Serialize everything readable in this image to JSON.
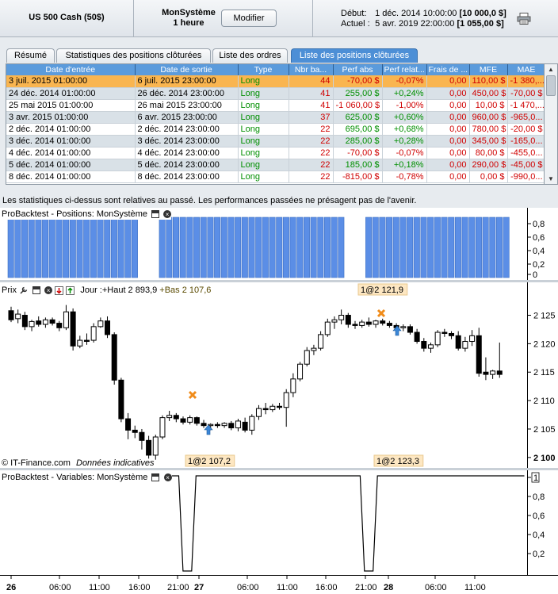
{
  "header": {
    "instrument": "US 500 Cash (50$)",
    "system_name": "MonSystème",
    "system_period": "1 heure",
    "modify_label": "Modifier",
    "start_label": "Début:",
    "start_value": "1 déc. 2014 10:00:00",
    "start_capital": "[10 000,0 $]",
    "current_label": "Actuel :",
    "current_value": "5 avr. 2019 22:00:00",
    "current_capital": "[1 055,00 $]",
    "printer_icon": "printer-icon"
  },
  "tabs": [
    {
      "label": "Résumé",
      "active": false
    },
    {
      "label": "Statistiques des positions clôturées",
      "active": false
    },
    {
      "label": "Liste des ordres",
      "active": false
    },
    {
      "label": "Liste des positions clôturées",
      "active": true
    }
  ],
  "table": {
    "columns": [
      "Date d'entrée",
      "Date de sortie",
      "Type",
      "Nbr ba...",
      "Perf abs",
      "Perf relat...",
      "Frais de ...",
      "MFE",
      "MAE"
    ],
    "rows": [
      [
        "3 juil. 2015 01:00:00",
        "6 juil. 2015 23:00:00",
        "Long",
        "44",
        "-70,00 $",
        "-0,07%",
        "0,00",
        "110,00 $",
        "-1 380,..."
      ],
      [
        "24 déc. 2014 01:00:00",
        "26 déc. 2014 23:00:00",
        "Long",
        "41",
        "255,00 $",
        "+0,24%",
        "0,00",
        "450,00 $",
        "-70,00 $"
      ],
      [
        "25 mai 2015 01:00:00",
        "26 mai 2015 23:00:00",
        "Long",
        "41",
        "-1 060,00 $",
        "-1,00%",
        "0,00",
        "10,00 $",
        "-1 470,..."
      ],
      [
        "3 avr. 2015 01:00:00",
        "6 avr. 2015 23:00:00",
        "Long",
        "37",
        "625,00 $",
        "+0,60%",
        "0,00",
        "960,00 $",
        "-965,0..."
      ],
      [
        "2 déc. 2014 01:00:00",
        "2 déc. 2014 23:00:00",
        "Long",
        "22",
        "695,00 $",
        "+0,68%",
        "0,00",
        "780,00 $",
        "-20,00 $"
      ],
      [
        "3 déc. 2014 01:00:00",
        "3 déc. 2014 23:00:00",
        "Long",
        "22",
        "285,00 $",
        "+0,28%",
        "0,00",
        "345,00 $",
        "-165,0..."
      ],
      [
        "4 déc. 2014 01:00:00",
        "4 déc. 2014 23:00:00",
        "Long",
        "22",
        "-70,00 $",
        "-0,07%",
        "0,00",
        "80,00 $",
        "-455,0..."
      ],
      [
        "5 déc. 2014 01:00:00",
        "5 déc. 2014 23:00:00",
        "Long",
        "22",
        "185,00 $",
        "+0,18%",
        "0,00",
        "290,00 $",
        "-45,00 $"
      ],
      [
        "8 déc. 2014 01:00:00",
        "8 déc. 2014 23:00:00",
        "Long",
        "22",
        "-815,00 $",
        "-0,78%",
        "0,00",
        "0,00 $",
        "-990,0..."
      ]
    ]
  },
  "disclaimer": "Les statistiques ci-dessus sont relatives au passé. Les performances passées ne présagent pas de l'avenir.",
  "positions_panel": {
    "title": "ProBacktest - Positions: MonSystème",
    "axis_ticks": [
      "0,8",
      "0,6",
      "0,4",
      "0,2",
      "0"
    ]
  },
  "price_panel": {
    "title": "Prix",
    "info": "Jour :+Haut 2 893,9",
    "info_overlap": "+Bas 2 107,6",
    "axis_ticks": [
      "2 125",
      "2 120",
      "2 115",
      "2 110",
      "2 105",
      "2 100"
    ],
    "order_labels": [
      "1@2 121,9",
      "1@2 107,2",
      "1@2 123,3"
    ],
    "watermark": "© IT-Finance.com",
    "watermark_note": "Données indicatives"
  },
  "variables_panel": {
    "title": "ProBacktest - Variables: MonSystème",
    "axis_ticks": [
      "1",
      "0,8",
      "0,6",
      "0,4",
      "0,2"
    ]
  },
  "time_axis": [
    "26",
    "06:00",
    "11:00",
    "16:00",
    "21:00",
    "27",
    "06:00",
    "11:00",
    "16:00",
    "21:00",
    "28",
    "06:00",
    "11:00"
  ],
  "chart_data": [
    {
      "type": "bar",
      "title": "ProBacktest - Positions: MonSystème",
      "values": [
        1,
        1,
        1,
        1,
        1,
        1,
        1,
        1,
        1,
        1,
        1,
        1,
        1,
        1,
        1,
        1,
        1,
        1,
        1,
        0,
        0,
        0,
        1,
        1,
        1,
        1,
        1,
        1,
        1,
        1,
        1,
        1,
        1,
        1,
        1,
        1,
        1,
        1,
        1,
        1,
        1,
        1,
        1,
        1,
        1,
        1,
        1,
        1,
        1,
        0,
        0,
        0,
        1,
        1,
        1,
        1,
        1,
        1,
        1,
        1,
        1,
        1,
        1,
        1,
        1,
        1,
        1,
        1,
        1,
        1,
        1,
        1,
        1
      ],
      "ylim": [
        0,
        1
      ]
    },
    {
      "type": "candlestick",
      "title": "Prix",
      "ylim": [
        2099,
        2128
      ],
      "candles": [
        {
          "o": 2125.8,
          "h": 2126.5,
          "l": 2123.8,
          "c": 2124.2
        },
        {
          "o": 2124.4,
          "h": 2126,
          "l": 2123.6,
          "c": 2125.2
        },
        {
          "o": 2125,
          "h": 2125.6,
          "l": 2122.4,
          "c": 2123
        },
        {
          "o": 2123,
          "h": 2124.2,
          "l": 2122.2,
          "c": 2123.9
        },
        {
          "o": 2124,
          "h": 2124.8,
          "l": 2123,
          "c": 2123.4
        },
        {
          "o": 2123.4,
          "h": 2124.6,
          "l": 2122.8,
          "c": 2124.2
        },
        {
          "o": 2124.2,
          "h": 2124.6,
          "l": 2123.2,
          "c": 2123.6
        },
        {
          "o": 2123.6,
          "h": 2124,
          "l": 2122.2,
          "c": 2122.8
        },
        {
          "o": 2122.8,
          "h": 2126.8,
          "l": 2122.4,
          "c": 2125.6
        },
        {
          "o": 2125.6,
          "h": 2126.2,
          "l": 2118.8,
          "c": 2119.6
        },
        {
          "o": 2119.6,
          "h": 2121.4,
          "l": 2119.2,
          "c": 2120.6
        },
        {
          "o": 2120.6,
          "h": 2121.8,
          "l": 2119.8,
          "c": 2120.4
        },
        {
          "o": 2120.6,
          "h": 2123.6,
          "l": 2120.2,
          "c": 2123
        },
        {
          "o": 2123,
          "h": 2124.6,
          "l": 2122.8,
          "c": 2124
        },
        {
          "o": 2124,
          "h": 2124.8,
          "l": 2121,
          "c": 2121.6
        },
        {
          "o": 2121.6,
          "h": 2122,
          "l": 2112.8,
          "c": 2113.6
        },
        {
          "o": 2113.6,
          "h": 2114,
          "l": 2106.2,
          "c": 2106.8
        },
        {
          "o": 2106.8,
          "h": 2107.8,
          "l": 2103.2,
          "c": 2104.8
        },
        {
          "o": 2104.8,
          "h": 2105.6,
          "l": 2103.4,
          "c": 2104.4
        },
        {
          "o": 2104.4,
          "h": 2105,
          "l": 2101.4,
          "c": 2103
        },
        {
          "o": 2103,
          "h": 2103.8,
          "l": 2099.8,
          "c": 2100.4
        },
        {
          "o": 2100.4,
          "h": 2104,
          "l": 2099.6,
          "c": 2103.6
        },
        {
          "o": 2103.6,
          "h": 2107.4,
          "l": 2103.2,
          "c": 2107
        },
        {
          "o": 2107,
          "h": 2108.2,
          "l": 2106.4,
          "c": 2107.4
        },
        {
          "o": 2107.4,
          "h": 2107.8,
          "l": 2106.2,
          "c": 2106.8
        },
        {
          "o": 2106.8,
          "h": 2107.2,
          "l": 2105.8,
          "c": 2106.2
        },
        {
          "o": 2106.2,
          "h": 2107.4,
          "l": 2105.8,
          "c": 2107
        },
        {
          "o": 2107,
          "h": 2107.2,
          "l": 2105.6,
          "c": 2106
        },
        {
          "o": 2106,
          "h": 2106.6,
          "l": 2105.2,
          "c": 2105.6
        },
        {
          "o": 2105.6,
          "h": 2106,
          "l": 2104.8,
          "c": 2105.8
        },
        {
          "o": 2105.8,
          "h": 2106.2,
          "l": 2105.2,
          "c": 2105.6
        },
        {
          "o": 2105.6,
          "h": 2106.2,
          "l": 2105.2,
          "c": 2106
        },
        {
          "o": 2106,
          "h": 2106.4,
          "l": 2104.8,
          "c": 2105.2
        },
        {
          "o": 2105.2,
          "h": 2106.8,
          "l": 2104.6,
          "c": 2106.4
        },
        {
          "o": 2106.2,
          "h": 2107,
          "l": 2104.4,
          "c": 2104.8
        },
        {
          "o": 2104.8,
          "h": 2107.6,
          "l": 2104,
          "c": 2107.2
        },
        {
          "o": 2107.2,
          "h": 2109.2,
          "l": 2106.6,
          "c": 2108.6
        },
        {
          "o": 2108.6,
          "h": 2109.6,
          "l": 2107.6,
          "c": 2108.4
        },
        {
          "o": 2108.4,
          "h": 2109.4,
          "l": 2108,
          "c": 2109
        },
        {
          "o": 2109,
          "h": 2109.6,
          "l": 2108.4,
          "c": 2108.8
        },
        {
          "o": 2108.8,
          "h": 2112,
          "l": 2105.4,
          "c": 2111.4
        },
        {
          "o": 2111.4,
          "h": 2114.8,
          "l": 2110.6,
          "c": 2113.8
        },
        {
          "o": 2113.8,
          "h": 2116.8,
          "l": 2113.4,
          "c": 2116.4
        },
        {
          "o": 2116.4,
          "h": 2119.4,
          "l": 2116,
          "c": 2118.8
        },
        {
          "o": 2118.8,
          "h": 2119.8,
          "l": 2118,
          "c": 2119.2
        },
        {
          "o": 2119.2,
          "h": 2122.2,
          "l": 2118.8,
          "c": 2121.6
        },
        {
          "o": 2121.6,
          "h": 2124.4,
          "l": 2121.2,
          "c": 2123.8
        },
        {
          "o": 2123.8,
          "h": 2124.8,
          "l": 2122.6,
          "c": 2124.2
        },
        {
          "o": 2124.2,
          "h": 2126,
          "l": 2123.4,
          "c": 2125
        },
        {
          "o": 2125,
          "h": 2125.4,
          "l": 2122.8,
          "c": 2123.4
        },
        {
          "o": 2123.4,
          "h": 2124,
          "l": 2122.6,
          "c": 2123.2
        },
        {
          "o": 2123.2,
          "h": 2124.2,
          "l": 2122.8,
          "c": 2123.8
        },
        {
          "o": 2123.8,
          "h": 2124.6,
          "l": 2123,
          "c": 2123.4
        },
        {
          "o": 2123.4,
          "h": 2124.2,
          "l": 2122.8,
          "c": 2124
        },
        {
          "o": 2124,
          "h": 2124.4,
          "l": 2123.2,
          "c": 2123.6
        },
        {
          "o": 2123.6,
          "h": 2124,
          "l": 2122.8,
          "c": 2123.2
        },
        {
          "o": 2123.2,
          "h": 2123.6,
          "l": 2122.4,
          "c": 2122.8
        },
        {
          "o": 2122.8,
          "h": 2123.4,
          "l": 2122.2,
          "c": 2123
        },
        {
          "o": 2123,
          "h": 2123.4,
          "l": 2121.6,
          "c": 2122
        },
        {
          "o": 2122,
          "h": 2122.6,
          "l": 2120,
          "c": 2120.4
        },
        {
          "o": 2120.4,
          "h": 2121,
          "l": 2118.6,
          "c": 2119.2
        },
        {
          "o": 2119.2,
          "h": 2120.2,
          "l": 2118.4,
          "c": 2119.8
        },
        {
          "o": 2119.8,
          "h": 2122.4,
          "l": 2119.4,
          "c": 2122
        },
        {
          "o": 2122,
          "h": 2122.6,
          "l": 2121.2,
          "c": 2121.8
        },
        {
          "o": 2121.8,
          "h": 2122.2,
          "l": 2120.8,
          "c": 2121.4
        },
        {
          "o": 2121.4,
          "h": 2122.2,
          "l": 2118.8,
          "c": 2119.2
        },
        {
          "o": 2119.2,
          "h": 2121.2,
          "l": 2118.6,
          "c": 2120.4
        },
        {
          "o": 2120.4,
          "h": 2122.4,
          "l": 2119.6,
          "c": 2121.4
        },
        {
          "o": 2121.4,
          "h": 2122.8,
          "l": 2114.2,
          "c": 2114.8
        },
        {
          "o": 2115,
          "h": 2117.6,
          "l": 2113.6,
          "c": 2114.6
        },
        {
          "o": 2114.6,
          "h": 2115.4,
          "l": 2113.8,
          "c": 2115.2
        },
        {
          "o": 2115.2,
          "h": 2120.2,
          "l": 2114,
          "c": 2114.6
        }
      ]
    },
    {
      "type": "line",
      "title": "ProBacktest - Variables: MonSystème",
      "ylim": [
        0,
        1
      ],
      "points": [
        [
          0,
          1
        ],
        [
          41,
          1
        ],
        [
          42,
          0
        ],
        [
          44,
          0
        ],
        [
          45,
          1
        ],
        [
          83,
          1
        ],
        [
          84,
          0
        ],
        [
          86,
          0
        ],
        [
          87,
          1
        ],
        [
          121,
          1
        ]
      ]
    }
  ],
  "colors": {
    "accent_tab": "#4d8fd6",
    "table_header": "#5b9bdc",
    "selected_row": "#f9b550",
    "position_bar": "#5b8ee6",
    "negative": "#d00000",
    "positive": "#008f00"
  }
}
